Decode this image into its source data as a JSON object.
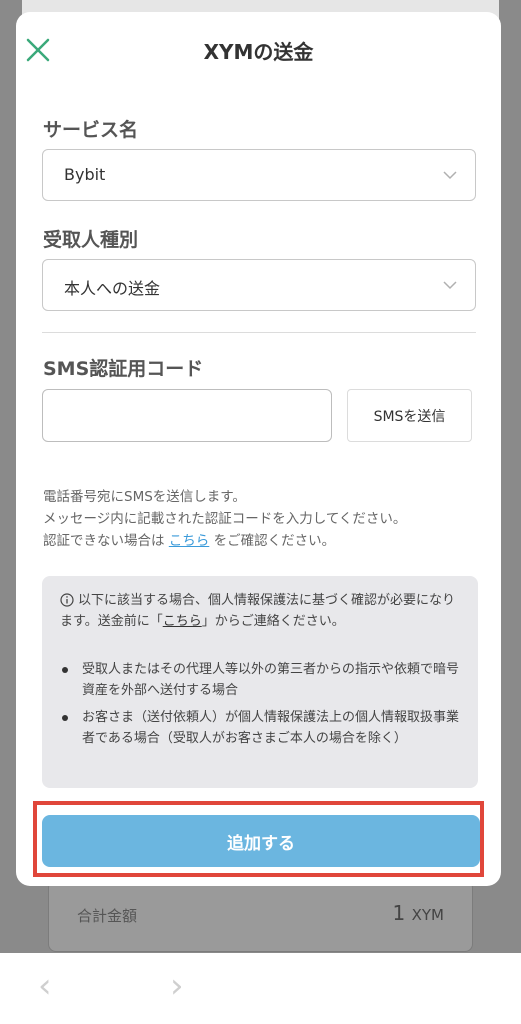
{
  "modal": {
    "title": "XYMの送金",
    "service": {
      "label": "サービス名",
      "value": "Bybit"
    },
    "recipient_type": {
      "label": "受取人種別",
      "value": "本人への送金"
    },
    "sms": {
      "label": "SMS認証用コード",
      "input_value": "",
      "input_placeholder": "",
      "send_button": "SMSを送信"
    },
    "help": {
      "line1": "電話番号宛にSMSを送信します。",
      "line2": "メッセージ内に記載された認証コードを入力してください。",
      "line3_prefix": "認証できない場合は",
      "line3_link": "こちら",
      "line3_suffix": "をご確認ください。"
    },
    "notice": {
      "head_prefix": "以下に該当する場合、個人情報保護法に基づく確認が必要になります。送金前に「",
      "head_link": "こちら",
      "head_suffix": "」からご連絡ください。",
      "items": [
        "受取人またはその代理人等以外の第三者からの指示や依頼で暗号資産を外部へ送付する場合",
        "お客さま（送付依頼人）が個人情報保護法上の個人情報取扱事業者である場合（受取人がお客さまご本人の場合を除く）"
      ]
    },
    "submit_button": "追加する"
  },
  "background": {
    "total_label": "合計金額",
    "total_value": "1",
    "total_unit": "XYM"
  },
  "colors": {
    "accent_green": "#3aa97a",
    "button_blue": "#6bb6e0",
    "highlight_red": "#e0463a",
    "link_blue": "#3a9ad9"
  },
  "icons": [
    "close-icon",
    "chevron-down-icon",
    "info-icon",
    "back-arrow-icon",
    "forward-arrow-icon"
  ]
}
